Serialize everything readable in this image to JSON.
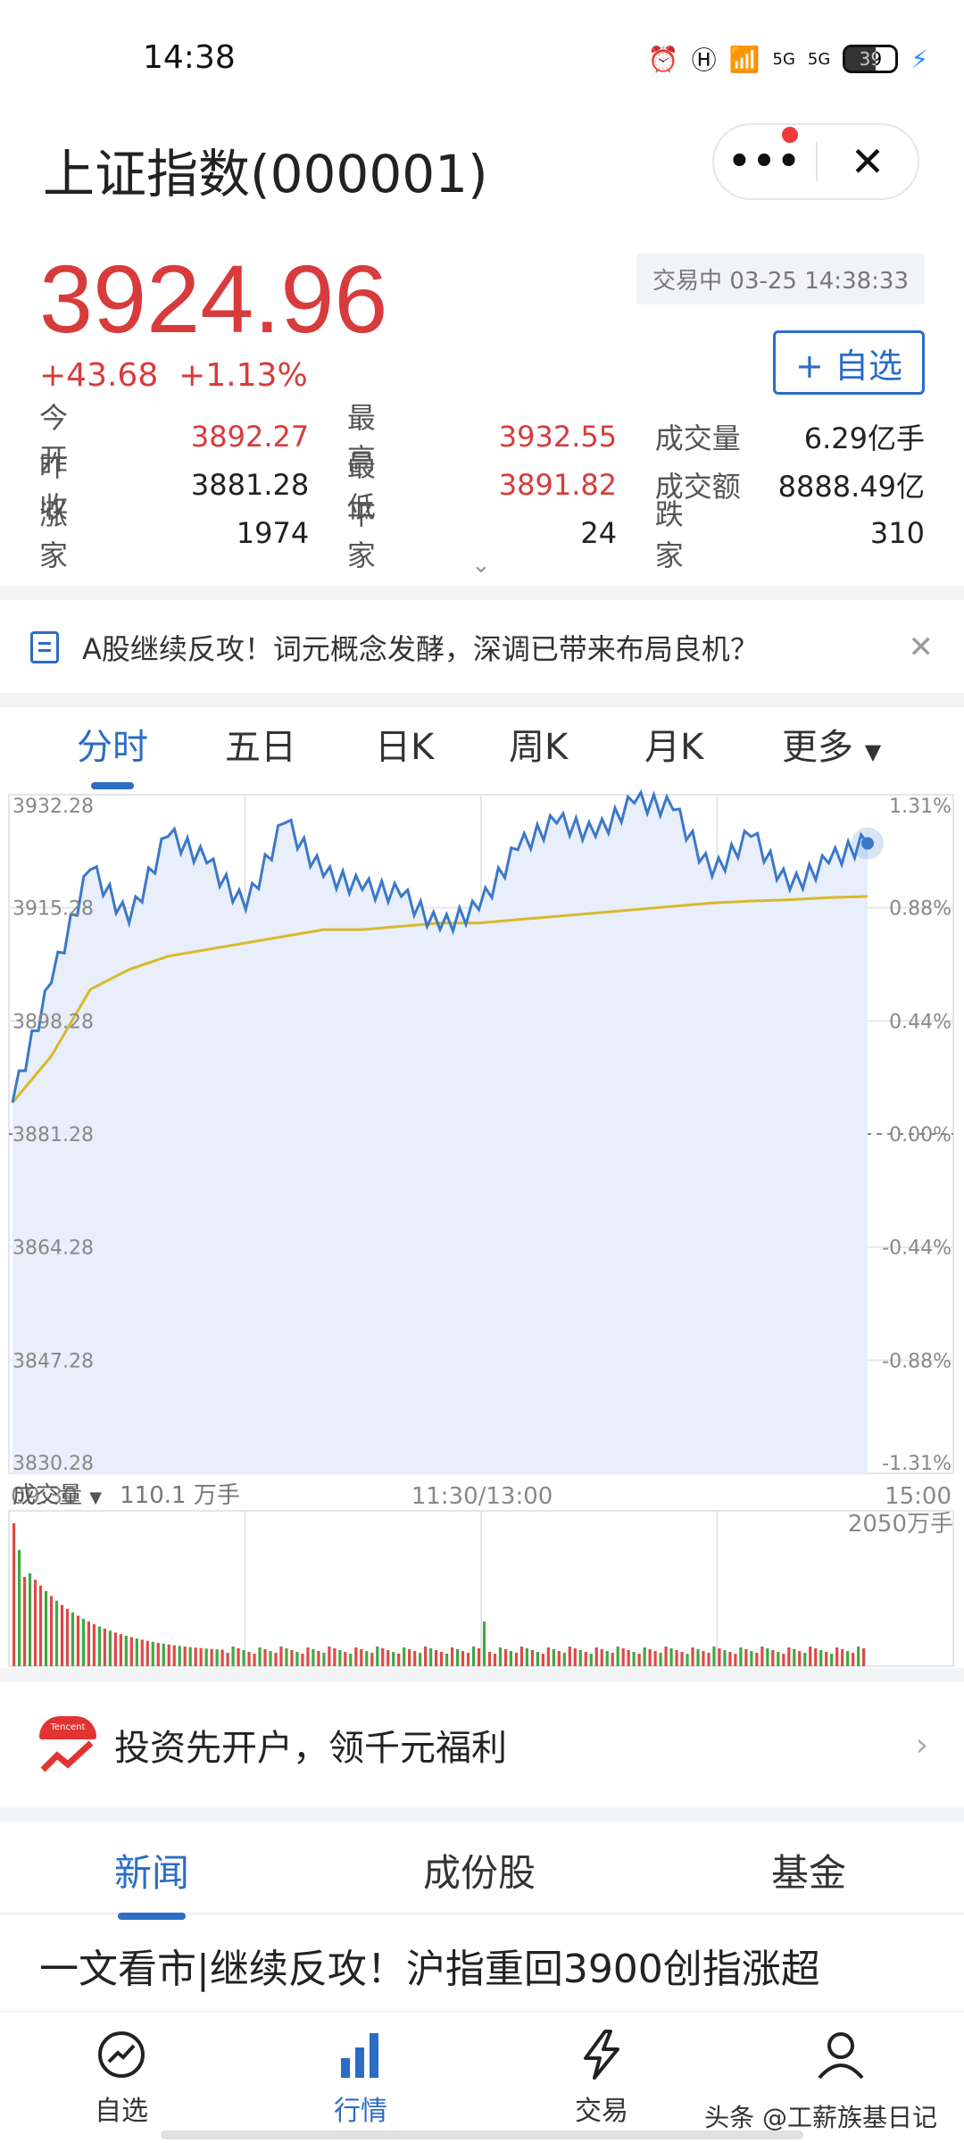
{
  "status_bar": {
    "time": "14:38",
    "battery": "39",
    "signal1": "5G",
    "signal2": "5G"
  },
  "header": {
    "title": "上证指数(000001)",
    "more": "•••",
    "close": "✕"
  },
  "quote": {
    "price": "3924.96",
    "change": "+43.68",
    "change_pct": "+1.13%",
    "status": "交易中 03-25 14:38:33",
    "watch_button": "+ 自选"
  },
  "stats": {
    "rows": [
      [
        {
          "label": "今开",
          "value": "3892.27"
        },
        {
          "label": "最高",
          "value": "3932.55"
        },
        {
          "label": "成交量",
          "value": "6.29亿手"
        }
      ],
      [
        {
          "label": "昨收",
          "value": "3881.28"
        },
        {
          "label": "最低",
          "value": "3891.82"
        },
        {
          "label": "成交额",
          "value": "8888.49亿"
        }
      ],
      [
        {
          "label": "涨家",
          "value": "1974"
        },
        {
          "label": "平家",
          "value": "24"
        },
        {
          "label": "跌家",
          "value": "310"
        }
      ]
    ]
  },
  "banner": {
    "text": "A股继续反攻！词元概念发酵，深调已带来布局良机？"
  },
  "chart_tabs": [
    "分时",
    "五日",
    "日K",
    "周K",
    "月K",
    "更多"
  ],
  "chart_axes": {
    "y_left": [
      "3932.28",
      "3915.28",
      "3898.28",
      "3881.28",
      "3864.28",
      "3847.28",
      "3830.28"
    ],
    "y_right": [
      "1.31%",
      "0.88%",
      "0.44%",
      "0.00%",
      "-0.44%",
      "-0.88%",
      "-1.31%"
    ],
    "x": [
      "09:30",
      "11:30/13:00",
      "15:00"
    ]
  },
  "volume": {
    "label": "成交量",
    "value": "110.1 万手",
    "max": "2050万手"
  },
  "chart_data": {
    "type": "line",
    "ylim": [
      3830.28,
      3932.28
    ],
    "series": [
      {
        "x": [
          "09:30",
          "09:40",
          "09:50",
          "10:00",
          "10:10",
          "10:20",
          "10:30",
          "10:40",
          "10:50",
          "11:00",
          "11:10",
          "11:20",
          "11:30",
          "13:10",
          "13:20",
          "13:30",
          "13:40",
          "13:50",
          "14:00",
          "14:10",
          "14:20",
          "14:30",
          "14:38"
        ],
        "values": [
          3886,
          3904,
          3921,
          3913,
          3926,
          3922,
          3915,
          3928,
          3920,
          3918,
          3917,
          3912,
          3915,
          3924,
          3928,
          3926,
          3931,
          3930,
          3920,
          3926,
          3918,
          3922,
          3924.96
        ]
      },
      {
        "x": [
          "09:30",
          "09:40",
          "09:50",
          "10:00",
          "10:10",
          "10:20",
          "10:30",
          "10:40",
          "10:50",
          "11:00",
          "11:10",
          "11:20",
          "11:30",
          "13:10",
          "13:20",
          "13:30",
          "13:40",
          "13:50",
          "14:00",
          "14:10",
          "14:20",
          "14:30",
          "14:38"
        ],
        "values": [
          3886,
          3893,
          3903,
          3906,
          3908,
          3909,
          3910,
          3911,
          3912,
          3912,
          3912.5,
          3913,
          3913,
          3913.5,
          3914,
          3914.5,
          3915,
          3915.5,
          3916,
          3916.3,
          3916.5,
          3916.8,
          3917
        ]
      }
    ]
  },
  "promo": {
    "text": "投资先开户，领千元福利",
    "logo": "Tencent"
  },
  "news_tabs": [
    "新闻",
    "成份股",
    "基金"
  ],
  "headline": "一文看市|继续反攻！沪指重回3900创指涨超",
  "bottom_nav": [
    "自选",
    "行情",
    "交易",
    "我的"
  ],
  "watermark": "头条 @工薪族基日记"
}
